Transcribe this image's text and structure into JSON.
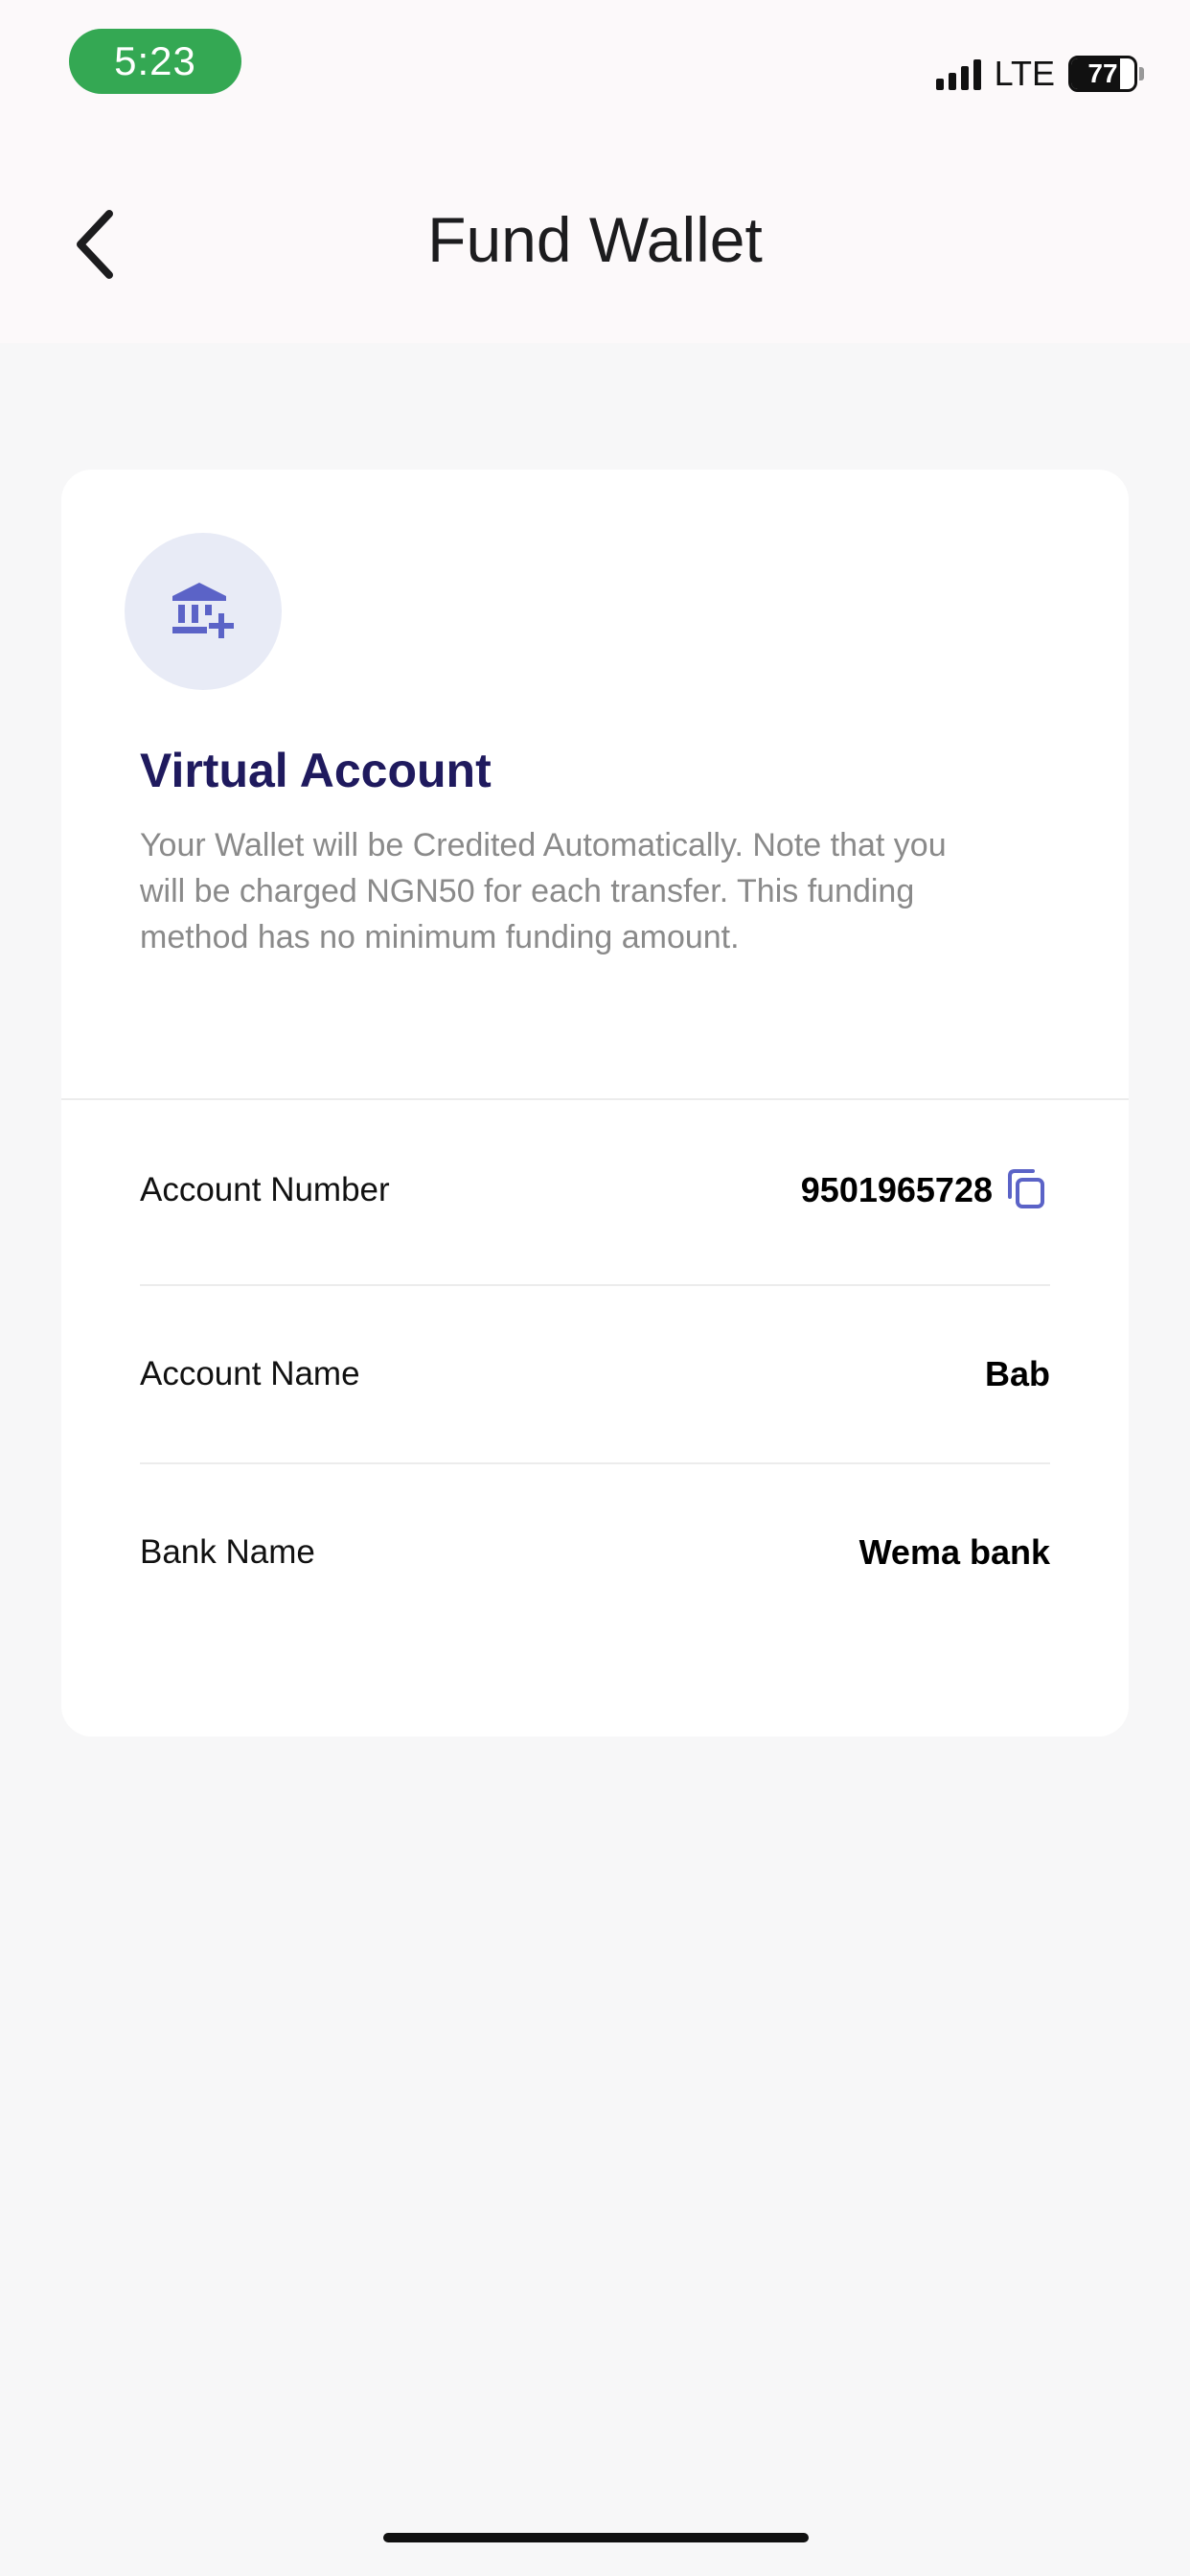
{
  "status_bar": {
    "time": "5:23",
    "network": "LTE",
    "battery_level": "77",
    "battery_fraction": 0.77
  },
  "header": {
    "title": "Fund Wallet",
    "back_icon": "chevron-left-icon"
  },
  "virtual_account": {
    "icon": "bank-add-icon",
    "title": "Virtual Account",
    "description": "Your Wallet will be Credited Automatically. Note that you will be charged NGN50 for each transfer. This funding method has no minimum funding amount."
  },
  "details": [
    {
      "label": "Account Number",
      "value": "9501965728",
      "copy_icon": "copy-icon"
    },
    {
      "label": "Account Name",
      "value": "Bab"
    },
    {
      "label": "Bank Name",
      "value": "Wema bank"
    }
  ],
  "colors": {
    "accent": "#5b63c7",
    "title": "#1f1a5e",
    "icon_bg": "#e8ebf6",
    "status_time_bg": "#34a853"
  }
}
